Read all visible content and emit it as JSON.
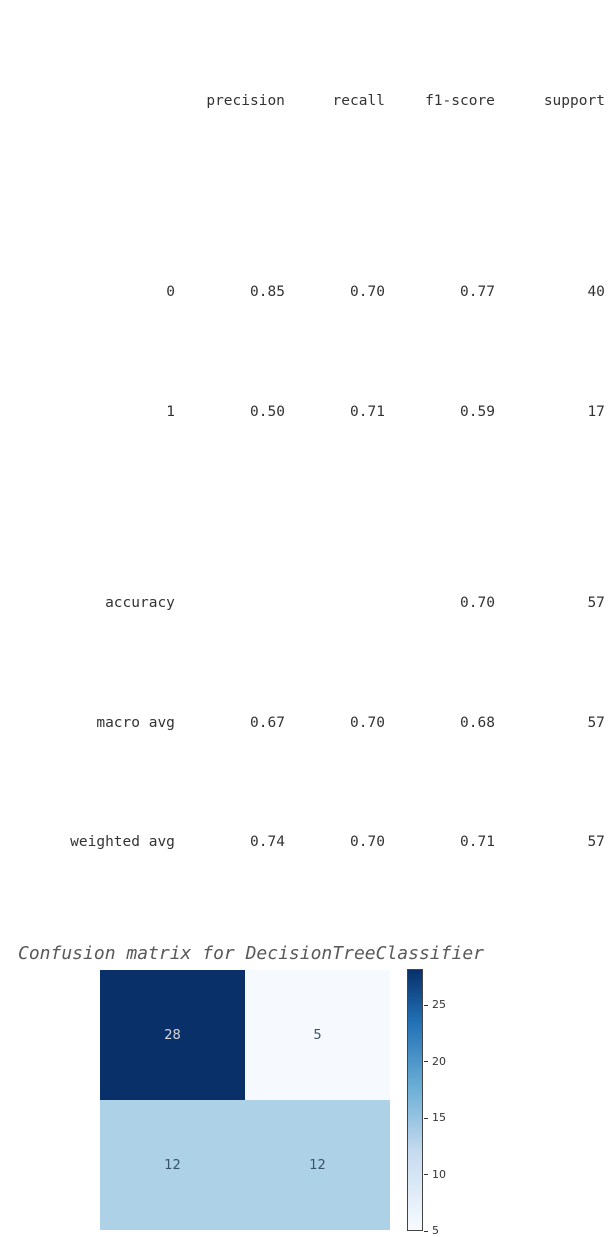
{
  "report": {
    "headers": {
      "name": "",
      "precision": "precision",
      "recall": "recall",
      "f1": "f1-score",
      "support": "support"
    },
    "rows": [
      {
        "name": "0",
        "precision": "0.85",
        "recall": "0.70",
        "f1": "0.77",
        "support": "40"
      },
      {
        "name": "1",
        "precision": "0.50",
        "recall": "0.71",
        "f1": "0.59",
        "support": "17"
      }
    ],
    "accuracy": {
      "name": "accuracy",
      "precision": "",
      "recall": "",
      "f1": "0.70",
      "support": "57"
    },
    "macro": {
      "name": "macro avg",
      "precision": "0.67",
      "recall": "0.70",
      "f1": "0.68",
      "support": "57"
    },
    "weighted": {
      "name": "weighted avg",
      "precision": "0.74",
      "recall": "0.70",
      "f1": "0.71",
      "support": "57"
    }
  },
  "chart_data": {
    "type": "heatmap",
    "title": "Confusion matrix for DecisionTreeClassifier",
    "matrix": [
      [
        28,
        5
      ],
      [
        12,
        12
      ]
    ],
    "colorbar_ticks": [
      5,
      10,
      15,
      20,
      25
    ],
    "vmin": 5,
    "vmax": 28,
    "colors_low_high": [
      "#f7fbff",
      "#08306b"
    ],
    "cell_colors": [
      "#0a3069",
      "#f6faff",
      "#add2e7",
      "#add2e7"
    ],
    "cell_text_colors": [
      "#d6d8da",
      "#39526c",
      "#39526c",
      "#39526c"
    ]
  }
}
